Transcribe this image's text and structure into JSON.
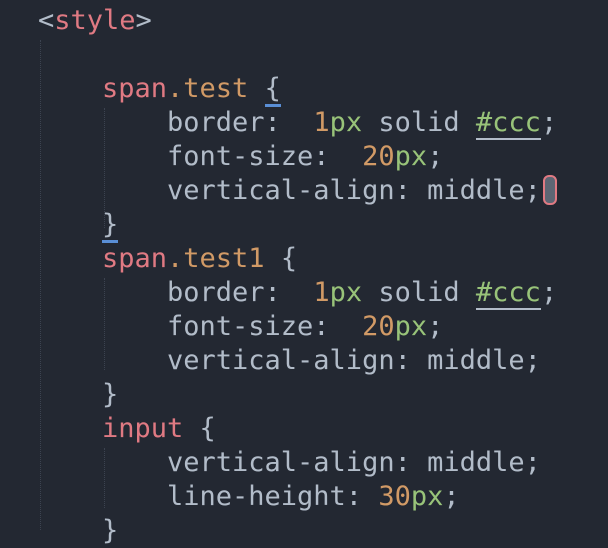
{
  "code": {
    "line1": {
      "open": "<",
      "tag": "style",
      "close": ">"
    },
    "rule1": {
      "selector_tag": "span",
      "selector_class": ".test",
      "open_brace": "{",
      "border_prop": "border:",
      "border_num": "1",
      "border_unit": "px",
      "border_rest": "solid",
      "border_color": "#ccc",
      "semi": ";",
      "font_prop": "font-size:",
      "font_num": "20",
      "font_unit": "px",
      "valign_prop": "vertical-align:",
      "valign_val": "middle",
      "close_brace": "}"
    },
    "rule2": {
      "selector_tag": "span",
      "selector_class": ".test1",
      "open_brace": "{",
      "border_prop": "border:",
      "border_num": "1",
      "border_unit": "px",
      "border_rest": "solid",
      "border_color": "#ccc",
      "semi": ";",
      "font_prop": "font-size:",
      "font_num": "20",
      "font_unit": "px",
      "valign_prop": "vertical-align:",
      "valign_val": "middle",
      "close_brace": "}"
    },
    "rule3": {
      "selector_tag": "input",
      "open_brace": "{",
      "valign_prop": "vertical-align:",
      "valign_val": "middle",
      "lh_prop": "line-height:",
      "lh_num": "30",
      "lh_unit": "px",
      "semi": ";",
      "close_brace": "}"
    }
  },
  "colors": {
    "background": "#232832",
    "tag": "#e07a83",
    "number": "#d19a66",
    "unit": "#98c379",
    "text": "#b2bcc9",
    "brace_match": "#5a8fd6"
  }
}
